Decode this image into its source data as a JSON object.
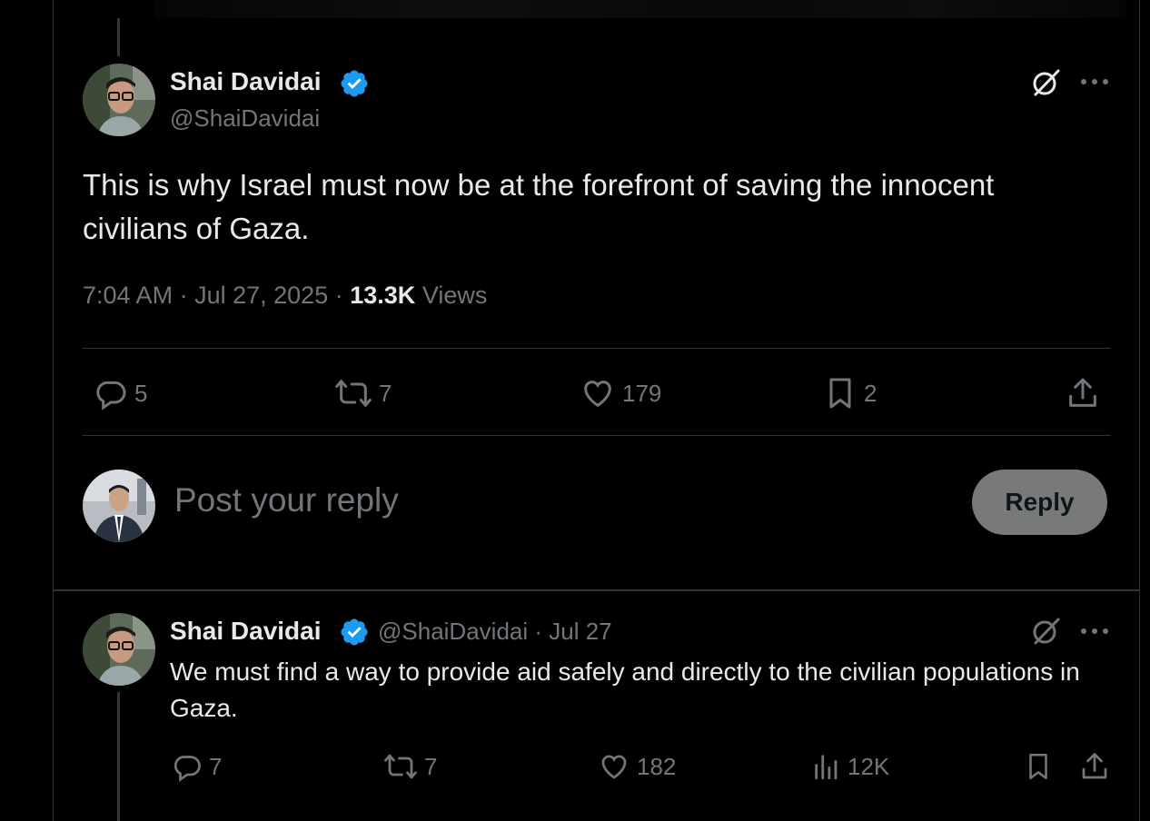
{
  "main_post": {
    "author_name": "Shai Davidai",
    "author_handle": "@ShaiDavidai",
    "text": "This is why Israel must now be at the forefront of saving the innocent civilians of Gaza.",
    "time": "7:04 AM",
    "date": "Jul 27, 2025",
    "separator": "·",
    "views_count": "13.3K",
    "views_label": "Views",
    "replies": "5",
    "reposts": "7",
    "likes": "179",
    "bookmarks": "2"
  },
  "composer": {
    "placeholder": "Post your reply",
    "button_label": "Reply"
  },
  "reply_post": {
    "author_name": "Shai Davidai",
    "author_handle": "@ShaiDavidai",
    "date": "· Jul 27",
    "text": "We must find a way to provide aid safely and directly to the civilian populations in Gaza.",
    "replies": "7",
    "reposts": "7",
    "likes": "182",
    "views": "12K"
  },
  "colors": {
    "background": "#000000",
    "text": "#e7e9ea",
    "muted": "#71767b",
    "verified": "#1d9bf0",
    "divider": "#2f3336"
  },
  "icons": [
    "verified-badge-icon",
    "grok-icon",
    "more-icon",
    "reply-icon",
    "repost-icon",
    "like-icon",
    "bookmark-icon",
    "share-icon",
    "views-icon"
  ]
}
